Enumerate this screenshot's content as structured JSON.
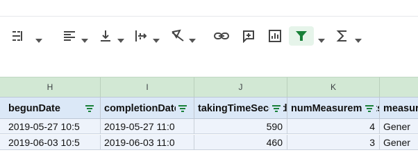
{
  "toolbar": {
    "buttons": [
      {
        "icon": "text-wrap-icon",
        "has_menu": true
      },
      {
        "icon": "horizontal-align-icon",
        "has_menu": true
      },
      {
        "icon": "vertical-align-icon",
        "has_menu": true
      },
      {
        "icon": "text-direction-icon",
        "has_menu": true
      },
      {
        "icon": "text-rotation-icon",
        "has_menu": true
      },
      {
        "icon": "insert-link-icon",
        "has_menu": false
      },
      {
        "icon": "insert-comment-icon",
        "has_menu": false
      },
      {
        "icon": "insert-chart-icon",
        "has_menu": false
      },
      {
        "icon": "filter-icon",
        "has_menu": true,
        "active": true
      },
      {
        "icon": "functions-icon",
        "has_menu": true
      }
    ],
    "filter_color": "#188038"
  },
  "columns": [
    "H",
    "I",
    "J",
    "K"
  ],
  "headers": [
    "begunDate",
    "completionDate",
    "takingTimeSeconds",
    "numMeasurements",
    "measurementType"
  ],
  "rows": [
    [
      "2019-05-27 10:5",
      "2019-05-27 11:0",
      "590",
      "4",
      "Gener"
    ],
    [
      "2019-06-03 10:5",
      "2019-06-03 11:0",
      "460",
      "3",
      "Gener"
    ]
  ],
  "colors": {
    "column_header_bg": "#d2e8d4",
    "header_row_bg": "#dbe8f7",
    "data_row_bg": "#eef3fb",
    "filter_icon": "#188038"
  }
}
